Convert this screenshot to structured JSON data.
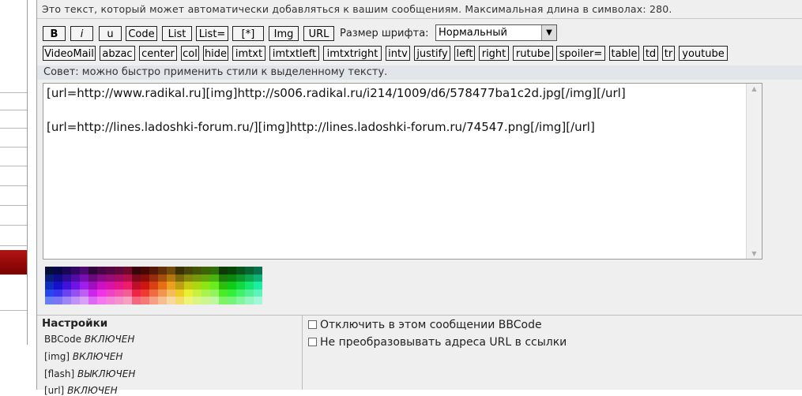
{
  "signature_hint": "Это текст, который может автоматически добавляться к вашим сообщениям. Максимальная длина в символах: 280.",
  "toolbar": {
    "row1": [
      "B",
      "i",
      "u",
      "Code",
      "List",
      "List=",
      "[*]",
      "Img",
      "URL"
    ],
    "row2": [
      "VideoMail",
      "abzac",
      "center",
      "col",
      "hide",
      "imtxt",
      "imtxtleft",
      "imtxtright",
      "intv",
      "justify",
      "left",
      "right",
      "rutube",
      "spoiler=",
      "table",
      "td",
      "tr",
      "youtube"
    ],
    "font_size_label": "Размер шрифта:",
    "font_size_value": "Нормальный"
  },
  "tip": "Совет: можно быстро применить стили к выделенному тексту.",
  "editor": {
    "line1": "[url=http://www.radikal.ru][img]http://s006.radikal.ru/i214/1009/d6/578477ba1c2d.jpg[/img][/url]",
    "line2": "[url=http://lines.ladoshki-forum.ru/][img]http://lines.ladoshki-forum.ru/74547.png[/img][/url]"
  },
  "settings": {
    "title": "Настройки",
    "rows": [
      {
        "label": "BBCode",
        "state": "ВКЛЮЧЕН"
      },
      {
        "label": "[img]",
        "state": "ВКЛЮЧЕН"
      },
      {
        "label": "[flash]",
        "state": "ВЫКЛЮЧЕН"
      },
      {
        "label": "[url]",
        "state": "ВКЛЮЧЕН"
      }
    ],
    "options": [
      "Отключить в этом сообщении BBCode",
      "Не преобразовывать адреса URL в ссылки"
    ]
  },
  "colors": {
    "panel_bg": "#efefef",
    "tip_bar": "#e2e6ea",
    "sidebar_red": "#9a0a0a"
  }
}
